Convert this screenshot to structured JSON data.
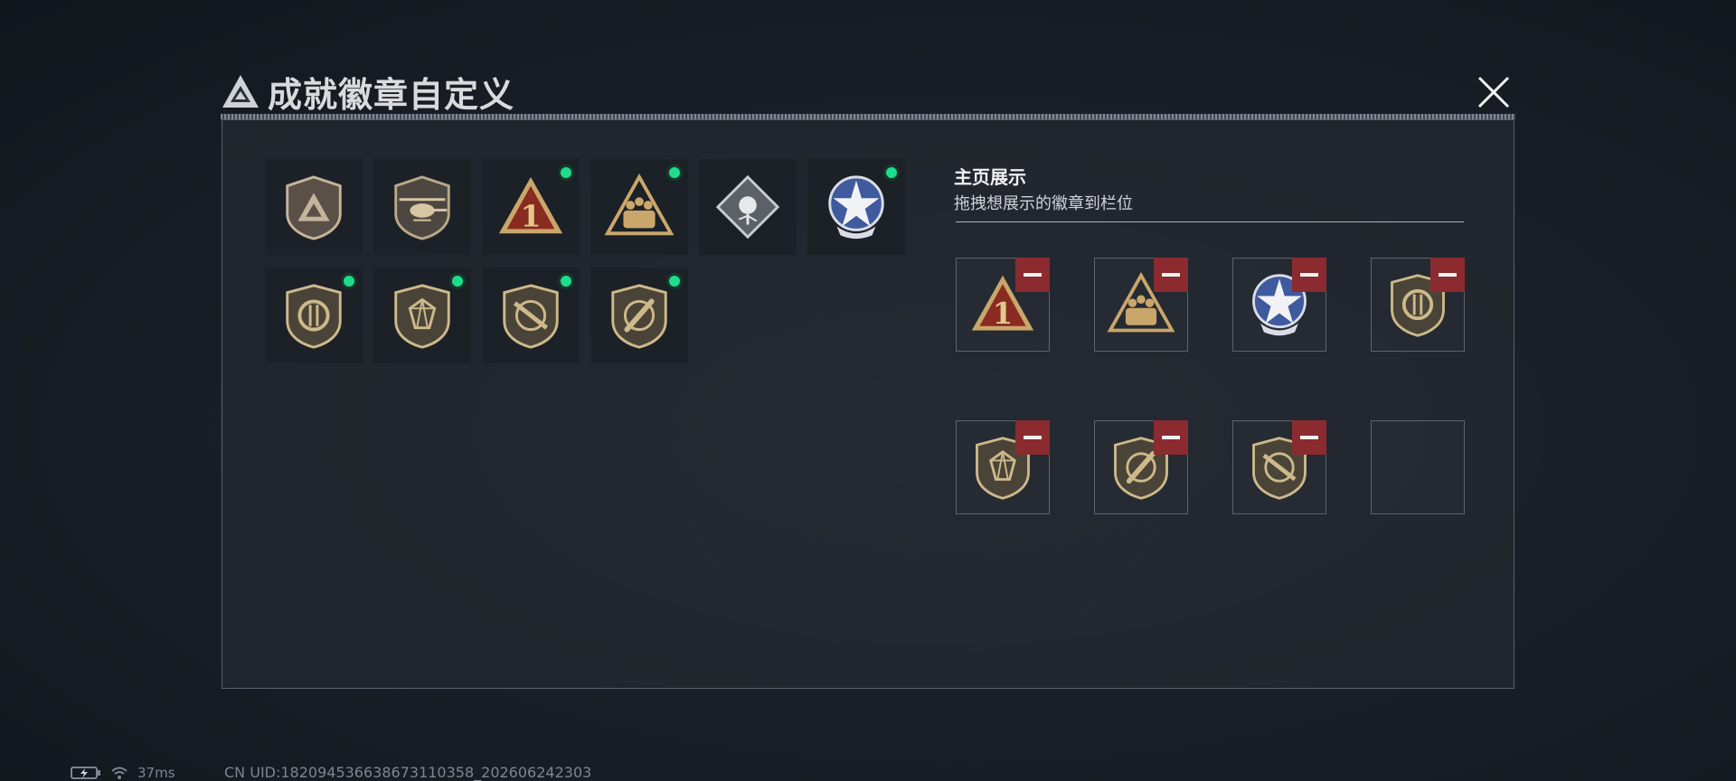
{
  "title": "成就徽章自定义",
  "showcase": {
    "title": "主页展示",
    "subtitle": "拖拽想展示的徽章到栏位"
  },
  "badges": [
    {
      "icon": "triangle-logo-shield-badge-icon",
      "new": false
    },
    {
      "icon": "helicopter-shield-badge-icon",
      "new": false
    },
    {
      "icon": "number-one-triangle-badge-icon",
      "new": true
    },
    {
      "icon": "soldiers-triangle-badge-icon",
      "new": true
    },
    {
      "icon": "rose-diamond-badge-icon",
      "new": false
    },
    {
      "icon": "star-emblem-badge-icon",
      "new": true
    },
    {
      "icon": "split-arrow-shield-badge-icon",
      "new": true
    },
    {
      "icon": "gem-shield-badge-icon",
      "new": true
    },
    {
      "icon": "rifle-shield-badge-icon",
      "new": true
    },
    {
      "icon": "knife-shield-badge-icon",
      "new": true
    }
  ],
  "slots": [
    {
      "icon": "number-one-triangle-badge-icon",
      "filled": true
    },
    {
      "icon": "soldiers-triangle-badge-icon",
      "filled": true
    },
    {
      "icon": "star-emblem-badge-icon",
      "filled": true
    },
    {
      "icon": "split-arrow-shield-badge-icon",
      "filled": true
    },
    {
      "icon": "gem-shield-badge-icon",
      "filled": true
    },
    {
      "icon": "knife-shield-badge-icon",
      "filled": true
    },
    {
      "icon": "rifle-shield-badge-icon",
      "filled": true
    },
    {
      "icon": "",
      "filled": false
    }
  ],
  "status": {
    "ping": "37ms",
    "uid": "CN UID:1820945366386731103​58_202606242303"
  },
  "colors": {
    "new_indicator": "#1fdc8c",
    "remove_button": "#8b2b2f",
    "panel_border": "#59606a"
  }
}
